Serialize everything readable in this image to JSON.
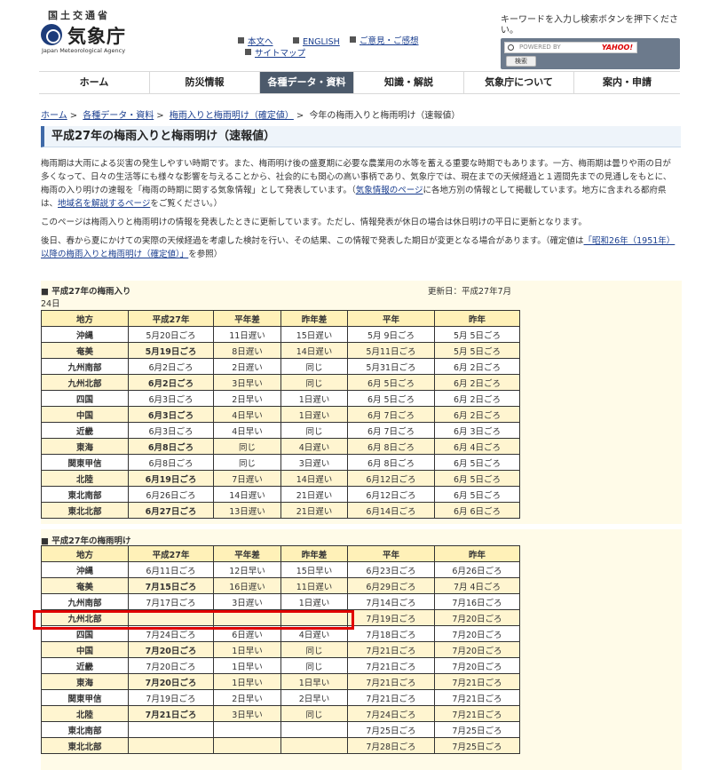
{
  "header": {
    "agency_top": "国土交通省",
    "agency_name": "気象庁",
    "agency_en": "Japan Meteorological Agency",
    "links": [
      "本文へ",
      "ENGLISH",
      "ご意見・ご感想",
      "サイトマップ"
    ],
    "search_hint": "キーワードを入力し検索ボタンを押下ください。",
    "search_placeholder": "POWERED BY",
    "search_brand": "YAHOO!",
    "search_button": "検索"
  },
  "nav": {
    "items": [
      "ホーム",
      "防災情報",
      "各種データ・資料",
      "知識・解説",
      "気象庁について",
      "案内・申請"
    ],
    "active_index": 2
  },
  "breadcrumb": {
    "links": [
      "ホーム",
      "各種データ・資料",
      "梅雨入りと梅雨明け（確定値）"
    ],
    "current": "今年の梅雨入りと梅雨明け（速報値）"
  },
  "page_title": "平成27年の梅雨入りと梅雨明け（速報値）",
  "intro": {
    "p1_a": "梅雨期は大雨による災害の発生しやすい時期です。また、梅雨明け後の盛夏期に必要な農業用の水等を蓄える重要な時期でもあります。一方、梅雨期は曇りや雨の日が多くなって、日々の生活等にも様々な影響を与えることから、社会的にも関心の高い事柄であり、気象庁では、現在までの天候経過と１週間先までの見通しをもとに、梅雨の入り明けの速報を「梅雨の時期に関する気象情報」として発表しています。（",
    "p1_link1": "気象情報のページ",
    "p1_b": "に各地方別の情報として掲載しています。地方に含まれる都府県は、",
    "p1_link2": "地域名を解説するページ",
    "p1_c": "をご覧ください。）",
    "p2": "このページは梅雨入りと梅雨明けの情報を発表したときに更新しています。ただし、情報発表が休日の場合は休日明けの平日に更新となります。",
    "p3_a": "後日、春から夏にかけての実際の天候経過を考慮した検討を行い、その結果、この情報で発表した期日が変更となる場合があります。（確定値は",
    "p3_link": "「昭和26年（1951年）以降の梅雨入りと梅雨明け（確定値）」",
    "p3_b": "を参照）"
  },
  "tsuyu_iri": {
    "title": "■ 平成27年の梅雨入り",
    "updated_a": "更新日：平成27年7月",
    "updated_b": "24日",
    "headers": [
      "地方",
      "平成27年",
      "平年差",
      "昨年差",
      "平年",
      "昨年"
    ],
    "rows": [
      [
        "沖縄",
        "5月20日ごろ",
        "11日遅い",
        "15日遅い",
        "5月 9日ごろ",
        "5月 5日ごろ"
      ],
      [
        "奄美",
        "5月19日ごろ",
        "8日遅い",
        "14日遅い",
        "5月11日ごろ",
        "5月 5日ごろ"
      ],
      [
        "九州南部",
        "6月2日ごろ",
        "2日遅い",
        "同じ",
        "5月31日ごろ",
        "6月 2日ごろ"
      ],
      [
        "九州北部",
        "6月2日ごろ",
        "3日早い",
        "同じ",
        "6月 5日ごろ",
        "6月 2日ごろ"
      ],
      [
        "四国",
        "6月3日ごろ",
        "2日早い",
        "1日遅い",
        "6月 5日ごろ",
        "6月 2日ごろ"
      ],
      [
        "中国",
        "6月3日ごろ",
        "4日早い",
        "1日遅い",
        "6月 7日ごろ",
        "6月 2日ごろ"
      ],
      [
        "近畿",
        "6月3日ごろ",
        "4日早い",
        "同じ",
        "6月 7日ごろ",
        "6月 3日ごろ"
      ],
      [
        "東海",
        "6月8日ごろ",
        "同じ",
        "4日遅い",
        "6月 8日ごろ",
        "6月 4日ごろ"
      ],
      [
        "関東甲信",
        "6月8日ごろ",
        "同じ",
        "3日遅い",
        "6月 8日ごろ",
        "6月 5日ごろ"
      ],
      [
        "北陸",
        "6月19日ごろ",
        "7日遅い",
        "14日遅い",
        "6月12日ごろ",
        "6月 5日ごろ"
      ],
      [
        "東北南部",
        "6月26日ごろ",
        "14日遅い",
        "21日遅い",
        "6月12日ごろ",
        "6月 5日ごろ"
      ],
      [
        "東北北部",
        "6月27日ごろ",
        "13日遅い",
        "21日遅い",
        "6月14日ごろ",
        "6月 6日ごろ"
      ]
    ]
  },
  "tsuyu_ake": {
    "title": "■ 平成27年の梅雨明け",
    "headers": [
      "地方",
      "平成27年",
      "平年差",
      "昨年差",
      "平年",
      "昨年"
    ],
    "rows": [
      [
        "沖縄",
        "6月11日ごろ",
        "12日早い",
        "15日早い",
        "6月23日ごろ",
        "6月26日ごろ"
      ],
      [
        "奄美",
        "7月15日ごろ",
        "16日遅い",
        "11日遅い",
        "6月29日ごろ",
        "7月 4日ごろ"
      ],
      [
        "九州南部",
        "7月17日ごろ",
        "3日遅い",
        "1日遅い",
        "7月14日ごろ",
        "7月16日ごろ"
      ],
      [
        "九州北部",
        "",
        "",
        "",
        "7月19日ごろ",
        "7月20日ごろ"
      ],
      [
        "四国",
        "7月24日ごろ",
        "6日遅い",
        "4日遅い",
        "7月18日ごろ",
        "7月20日ごろ"
      ],
      [
        "中国",
        "7月20日ごろ",
        "1日早い",
        "同じ",
        "7月21日ごろ",
        "7月20日ごろ"
      ],
      [
        "近畿",
        "7月20日ごろ",
        "1日早い",
        "同じ",
        "7月21日ごろ",
        "7月20日ごろ"
      ],
      [
        "東海",
        "7月20日ごろ",
        "1日早い",
        "1日早い",
        "7月21日ごろ",
        "7月21日ごろ"
      ],
      [
        "関東甲信",
        "7月19日ごろ",
        "2日早い",
        "2日早い",
        "7月21日ごろ",
        "7月21日ごろ"
      ],
      [
        "北陸",
        "7月21日ごろ",
        "3日早い",
        "同じ",
        "7月24日ごろ",
        "7月21日ごろ"
      ],
      [
        "東北南部",
        "",
        "",
        "",
        "7月25日ごろ",
        "7月25日ごろ"
      ],
      [
        "東北北部",
        "",
        "",
        "",
        "7月28日ごろ",
        "7月25日ごろ"
      ]
    ]
  },
  "colors": {
    "nav_active": "#4c5a6b",
    "table_header": "#fff1b8",
    "link": "#1a3e8f",
    "highlight": "#e00000"
  }
}
